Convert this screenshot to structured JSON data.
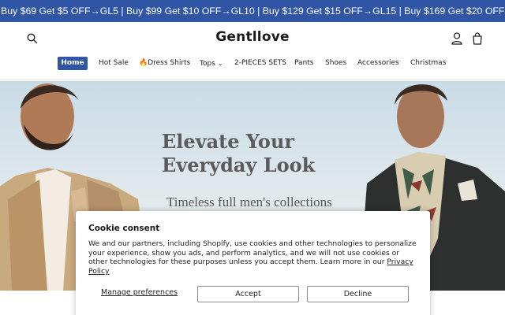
{
  "announcement": {
    "text": "Buy $69 Get $5 OFF→GL5 | Buy $99 Get $10 OFF→GL10 | Buy $129 Get $15 OFF→GL15 | Buy $169 Get $20 OFF→GL20 |"
  },
  "header": {
    "logo": "Gentllove",
    "icons": {
      "search": "search-icon",
      "account": "account-icon",
      "cart": "cart-icon"
    }
  },
  "nav": {
    "items": [
      {
        "label": "Home",
        "active": true
      },
      {
        "label": "Hot Sale"
      },
      {
        "label": "🔥Dress Shirts"
      },
      {
        "label": "Tops",
        "has_dropdown": true
      },
      {
        "label": "2-PIECES SETS"
      },
      {
        "label": "Pants"
      },
      {
        "label": "Shoes"
      },
      {
        "label": "Accessories"
      },
      {
        "label": "Christmas"
      }
    ]
  },
  "hero": {
    "headline": "Elevate Your Everyday Look",
    "subheadline": "Timeless full men's collections"
  },
  "cookie": {
    "title": "Cookie consent",
    "body": "We and our partners, including Shopify, use cookies and other technologies to personalize your experience, show you ads, and perform analytics, and we will not use cookies or other technologies for these purposes unless you accept them. Learn more in our",
    "privacy_link": "Privacy Policy",
    "manage_label": "Manage preferences",
    "accept_label": "Accept",
    "decline_label": "Decline"
  },
  "colors": {
    "brand_blue": "#2f55a4",
    "text": "#121212"
  }
}
